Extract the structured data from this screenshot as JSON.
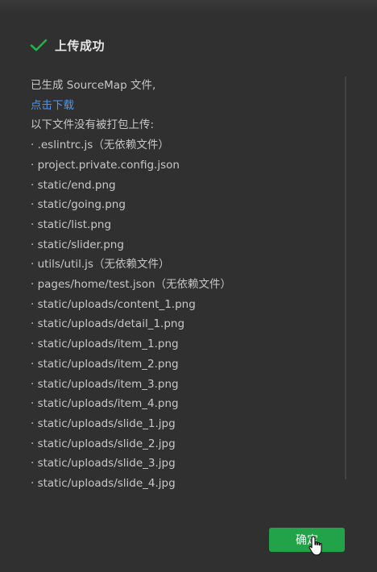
{
  "dialog": {
    "title": "上传成功",
    "icon": "check-icon",
    "accent_color": "#22a34a",
    "link_color": "#4a96f0"
  },
  "content": {
    "line1": "已生成 SourceMap 文件,",
    "download_link": "点击下载",
    "line3": "以下文件没有被打包上传:",
    "files": [
      "· .eslintrc.js（无依赖文件）",
      "· project.private.config.json",
      "· static/end.png",
      "· static/going.png",
      "· static/list.png",
      "· static/slider.png",
      "· utils/util.js（无依赖文件）",
      "· pages/home/test.json（无依赖文件）",
      "· static/uploads/content_1.png",
      "· static/uploads/detail_1.png",
      "· static/uploads/item_1.png",
      "· static/uploads/item_2.png",
      "· static/uploads/item_3.png",
      "· static/uploads/item_4.png",
      "· static/uploads/slide_1.jpg",
      "· static/uploads/slide_2.jpg",
      "· static/uploads/slide_3.jpg",
      "· static/uploads/slide_4.jpg"
    ]
  },
  "footer": {
    "confirm_label": "确定"
  }
}
